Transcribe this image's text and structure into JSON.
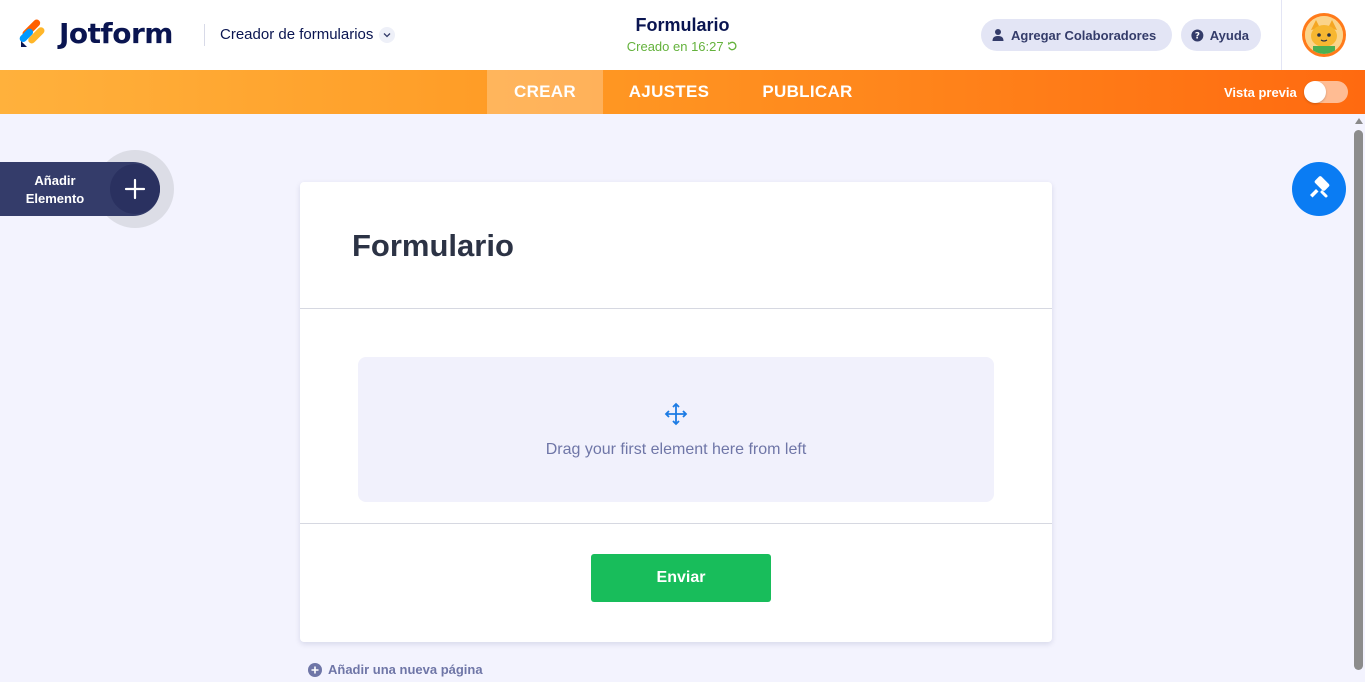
{
  "header": {
    "brand": "Jotform",
    "builder_label": "Creador de formularios",
    "form_title": "Formulario",
    "created_status": "Creado en 16:27",
    "collaborators_button": "Agregar Colaboradores",
    "help_button": "Ayuda"
  },
  "nav": {
    "tabs": [
      {
        "label": "CREAR",
        "active": true
      },
      {
        "label": "AJUSTES",
        "active": false
      },
      {
        "label": "PUBLICAR",
        "active": false
      }
    ],
    "preview_label": "Vista previa",
    "preview_enabled": false
  },
  "sidebar": {
    "add_element_line1": "Añadir",
    "add_element_line2": "Elemento"
  },
  "form": {
    "title": "Formulario",
    "dropzone_text": "Drag your first element here from left",
    "submit_label": "Enviar",
    "add_page_label": "Añadir una nueva página"
  },
  "colors": {
    "brand_navy": "#0a1551",
    "nav_orange": "#ff6a10",
    "submit_green": "#18bd5b",
    "theme_blue": "#0a7cf3",
    "created_green": "#64b23c"
  },
  "icons": [
    "jotform-logo-icon",
    "chevron-down-icon",
    "refresh-icon",
    "user-icon",
    "help-icon",
    "avatar",
    "plus-icon",
    "paint-roller-icon",
    "move-icon",
    "add-circle-icon"
  ]
}
